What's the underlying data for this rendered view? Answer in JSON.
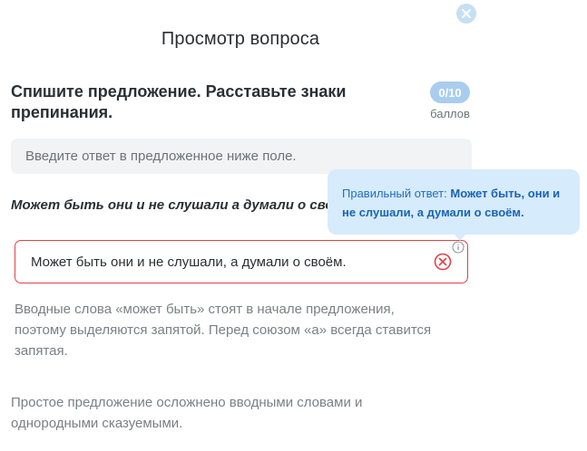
{
  "window": {
    "title": "Просмотр вопроса",
    "close_icon": "close-icon"
  },
  "question": {
    "text": "Спишите предложение. Расставьте знаки препинания.",
    "score_badge": "0/10",
    "score_unit": "баллов"
  },
  "input": {
    "placeholder_hint": "Введите ответ в предложенное ниже поле."
  },
  "sentence": "Может быть они и не слушали а думали о своём.",
  "answer": {
    "user_value": "Может быть они и не слушали, а думали о своём.",
    "status_icon": "wrong-answer-icon",
    "info_icon": "info-icon",
    "status_color": "#e0424a"
  },
  "tooltip": {
    "label": "Правильный ответ: ",
    "correct_answer": "Может быть, они и не слушали, а думали о своём."
  },
  "explanation": {
    "text": "Вводные слова «может быть» стоят в начале предложения, поэтому выделяются запятой. Перед союзом «а» всегда ставится запятая.",
    "extra": "Простое предложение осложнено вводными словами и однородными сказуемыми."
  }
}
